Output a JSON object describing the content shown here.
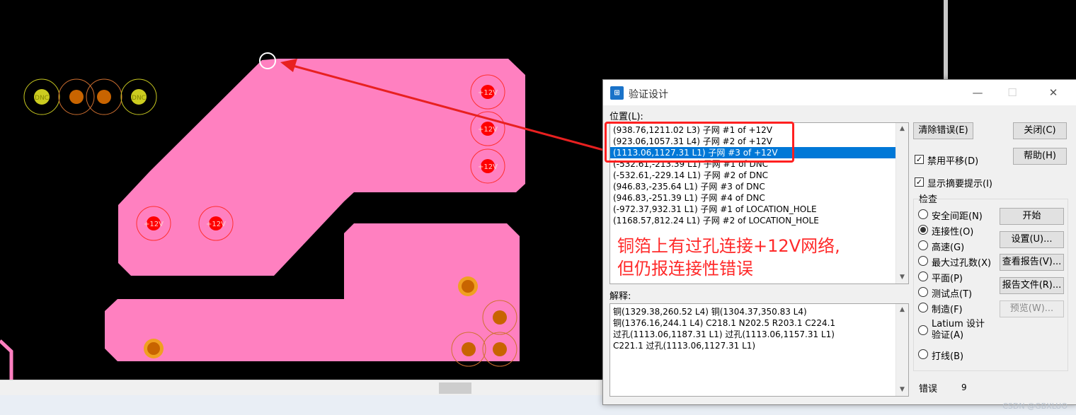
{
  "pcb": {
    "colors": {
      "background": "#000000",
      "copper_pour": "#ff80c0",
      "via_fill": "#ff0000",
      "via_ring": "#ff3030",
      "pad_gold": "#c86400",
      "pad_yellow": "#cccc20",
      "arrow": "#e82020"
    },
    "via_label": "+12V",
    "top_left_pads": [
      "DNC",
      "",
      "",
      "DNC"
    ]
  },
  "annotation": {
    "line1": "铜箔上有过孔连接+12V网络,",
    "line2": "但仍报连接性错误"
  },
  "watermark": "CSDN @GBXLUO",
  "dialog": {
    "title": "验证设计",
    "app_icon": "chip-icon",
    "location_label": "位置(L):",
    "locations": [
      "(938.76,1211.02 L3) 子网 #1 of +12V",
      "(923.06,1057.31 L4) 子网 #2 of +12V",
      "(1113.06,1127.31 L1) 子网 #3 of +12V",
      "(-532.61,-213.39 L1) 子网 #1 of DNC",
      "(-532.61,-229.14 L1) 子网 #2 of DNC",
      "(946.83,-235.64 L1) 子网 #3 of DNC",
      "(946.83,-251.39 L1) 子网 #4 of DNC",
      "(-972.37,932.31 L1) 子网 #1 of LOCATION_HOLE",
      "(1168.57,812.24 L1) 子网 #2 of LOCATION_HOLE"
    ],
    "selected_location_index": 2,
    "explain_label": "解释:",
    "explanation": [
      "铜(1329.38,260.52 L4) 铜(1304.37,350.83 L4)",
      "铜(1376.16,244.1 L4) C218.1 N202.5 R203.1 C224.1",
      "过孔(1113.06,1187.31 L1) 过孔(1113.06,1157.31 L1)",
      "C221.1 过孔(1113.06,1127.31 L1)"
    ],
    "buttons": {
      "clear_errors": "清除错误(E)",
      "close": "关闭(C)",
      "help": "帮助(H)",
      "start": "开始",
      "settings": "设置(U)...",
      "view_report": "查看报告(V)...",
      "report_file": "报告文件(R)...",
      "preview": "预览(W)..."
    },
    "checkboxes": {
      "disable_pan": {
        "label": "禁用平移(D)",
        "checked": true
      },
      "show_hints": {
        "label": "显示摘要提示(I)",
        "checked": true
      }
    },
    "check_group_label": "检查",
    "check_options": [
      {
        "label": "安全间距(N)",
        "selected": false
      },
      {
        "label": "连接性(O)",
        "selected": true
      },
      {
        "label": "高速(G)",
        "selected": false
      },
      {
        "label": "最大过孔数(X)",
        "selected": false
      },
      {
        "label": "平面(P)",
        "selected": false
      },
      {
        "label": "测试点(T)",
        "selected": false
      },
      {
        "label": "制造(F)",
        "selected": false
      },
      {
        "label_line1": "Latium 设计",
        "label_line2": "验证(A)",
        "selected": false
      },
      {
        "label": "打线(B)",
        "selected": false
      }
    ],
    "errors_label": "错误",
    "errors_count": "9"
  }
}
